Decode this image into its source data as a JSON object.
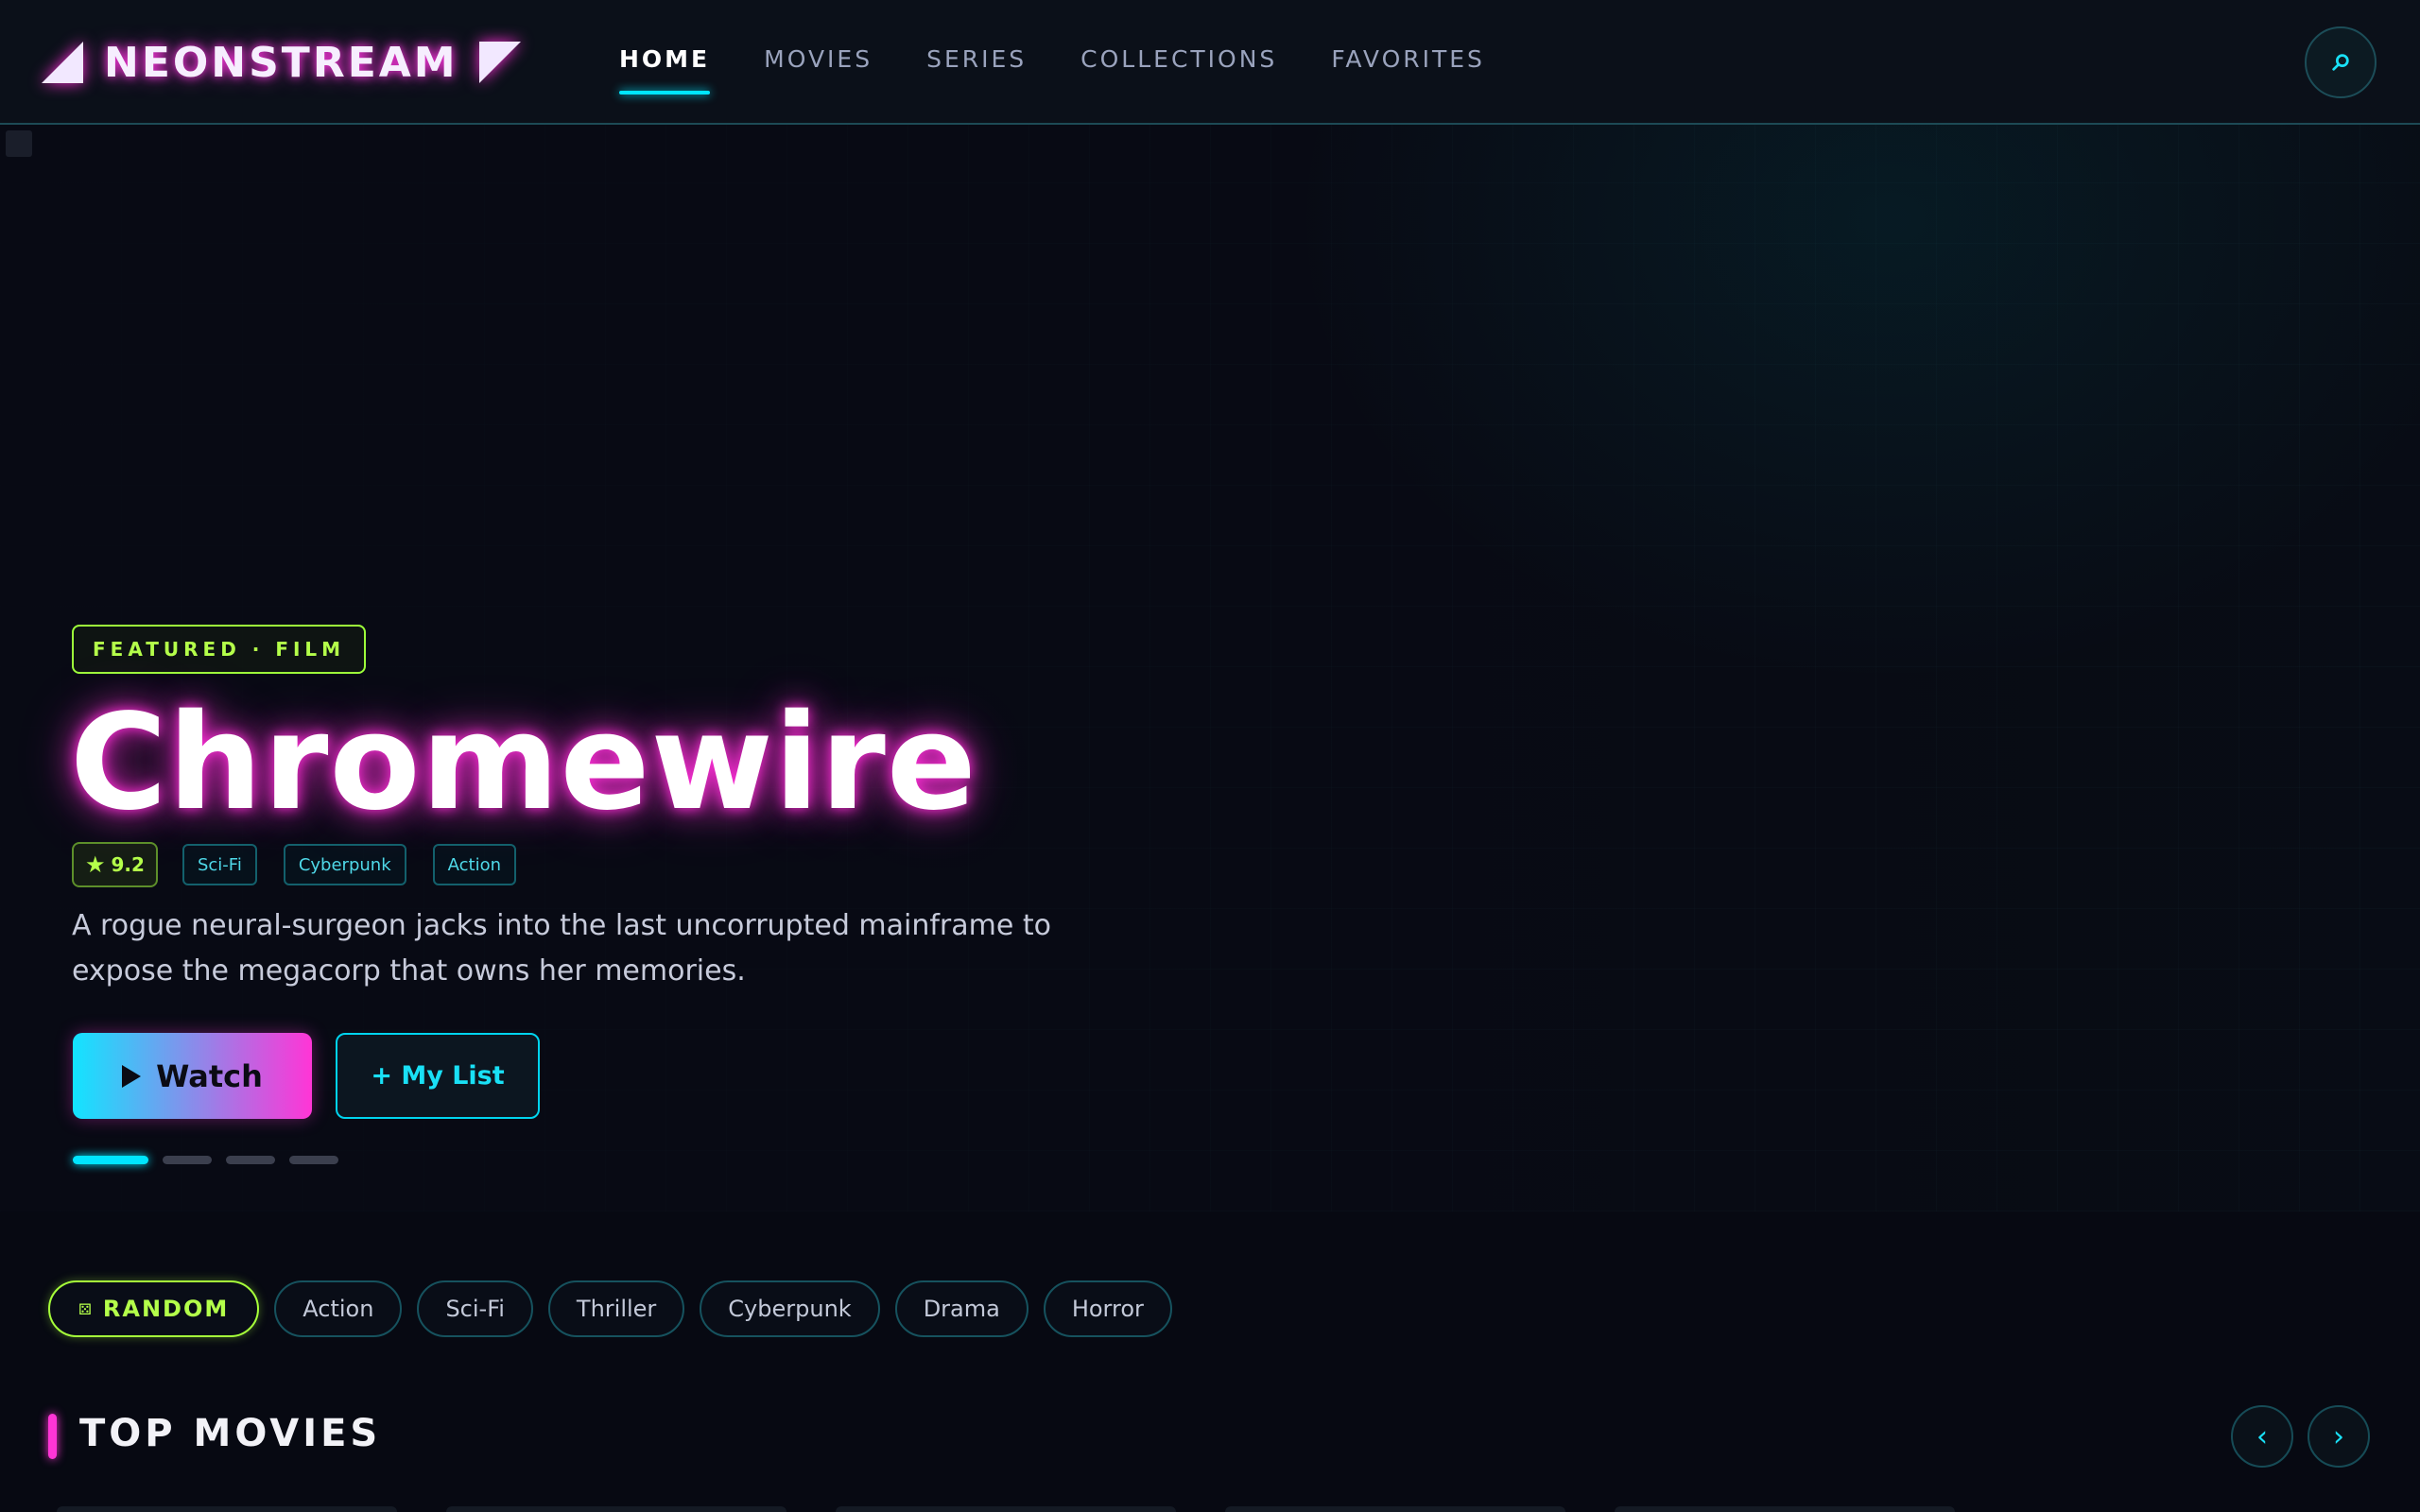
{
  "app": {
    "name": "NEONSTREAM"
  },
  "nav": {
    "items": [
      {
        "label": "HOME",
        "active": true
      },
      {
        "label": "MOVIES",
        "active": false
      },
      {
        "label": "SERIES",
        "active": false
      },
      {
        "label": "COLLECTIONS",
        "active": false
      },
      {
        "label": "FAVORITES",
        "active": false
      }
    ]
  },
  "icons": {
    "search": "search-icon",
    "play": "play-icon",
    "star": "star-icon",
    "dice": "dice-icon"
  },
  "hero": {
    "badge": "FEATURED · FILM",
    "title": "Chromewire",
    "rating": "9.2",
    "rating_star": "★",
    "tags": [
      "Sci-Fi",
      "Cyberpunk",
      "Action"
    ],
    "description": "A rogue neural-surgeon jacks into the last uncorrupted mainframe to expose the megacorp that owns her memories.",
    "watch_label": "Watch",
    "mylist_label": "+ My List",
    "slide_count": 4,
    "active_slide": 1
  },
  "genres": {
    "random_label": "RANDOM",
    "random_icon": "⚄",
    "items": [
      "Action",
      "Sci-Fi",
      "Thriller",
      "Cyberpunk",
      "Drama",
      "Horror"
    ]
  },
  "section": {
    "title": "TOP MOVIES",
    "prev_label": "‹",
    "next_label": "›"
  },
  "colors": {
    "cyan": "#00e5ff",
    "magenta": "#ff35d6",
    "lime": "#a6ff3a",
    "background": "#070912"
  }
}
